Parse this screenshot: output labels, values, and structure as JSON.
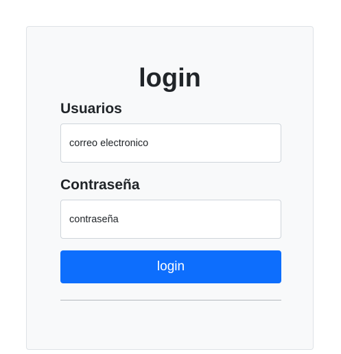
{
  "login_card": {
    "title": "login",
    "user_label": "Usuarios",
    "user_placeholder": "correo electronico",
    "password_label": "Contraseña",
    "password_placeholder": "contraseña",
    "submit_label": "login"
  },
  "colors": {
    "card_background": "#f8f9fa",
    "button_primary": "#0d6efd",
    "text": "#212529"
  }
}
